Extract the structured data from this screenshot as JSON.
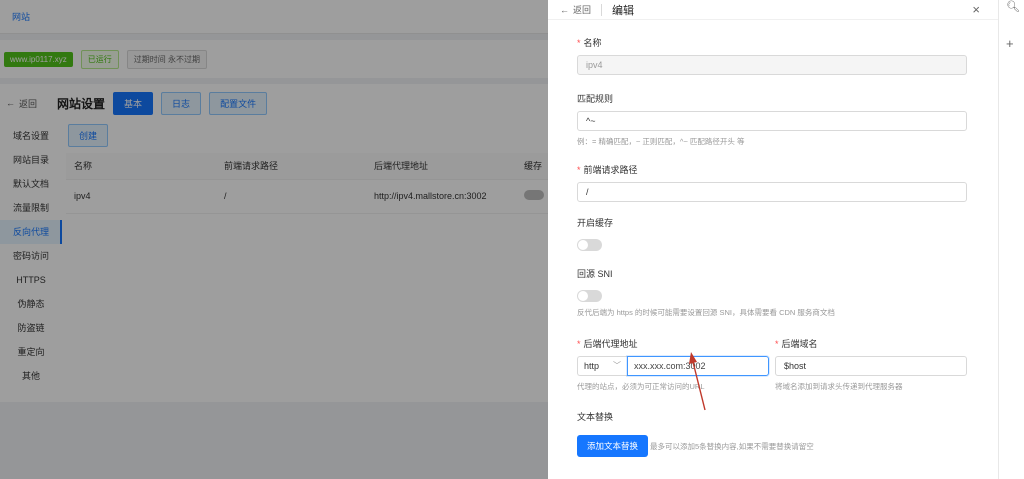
{
  "bg": {
    "topbar": {
      "nav": "网站"
    },
    "info": {
      "domain": "www.ip0117.xyz",
      "status": "已运行",
      "expire": "过期时间 永不过期"
    },
    "header": {
      "back": "返回",
      "title": "网站设置",
      "buttons": [
        "基本",
        "日志",
        "配置文件"
      ]
    },
    "side": [
      "域名设置",
      "网站目录",
      "默认文档",
      "流量限制",
      "反向代理",
      "密码访问",
      "HTTPS",
      "伪静态",
      "防盗链",
      "重定向",
      "其他"
    ],
    "create": "创建",
    "table": {
      "headers": [
        "名称",
        "前端请求路径",
        "后端代理地址",
        "缓存"
      ],
      "rows": [
        {
          "name": "ipv4",
          "path": "/",
          "backend": "http://ipv4.mallstore.cn:3002"
        }
      ]
    }
  },
  "drawer": {
    "back": "返回",
    "title": "编辑",
    "close": "×",
    "name_label": "名称",
    "name_value": "ipv4",
    "match_label": "匹配规则",
    "match_value": "^~",
    "match_help": "例：= 精确匹配，~ 正则匹配，^~ 匹配路径开头 等",
    "path_label": "前端请求路径",
    "path_value": "/",
    "cache_label": "开启缓存",
    "sni_label": "回源 SNI",
    "sni_help": "反代后端为 https 的时候可能需要设置回源 SNI，具体需要看 CDN 服务商文档",
    "backend_label": "后端代理地址",
    "scheme": "http",
    "backend_value": "xxx.xxx.com:3002",
    "backend_help": "代理的站点，必须为可正常访问的URL",
    "host_label": "后端域名",
    "host_value": "$host",
    "host_help": "将域名添加到请求头传递到代理服务器",
    "replace_label": "文本替换",
    "add_button": "添加文本替换",
    "add_help": "最多可以添加5条替换内容,如果不需要替换请留空"
  },
  "colors": {
    "primary": "#1677ff",
    "required": "#ff4d4f",
    "annotation": "#c0392b"
  }
}
